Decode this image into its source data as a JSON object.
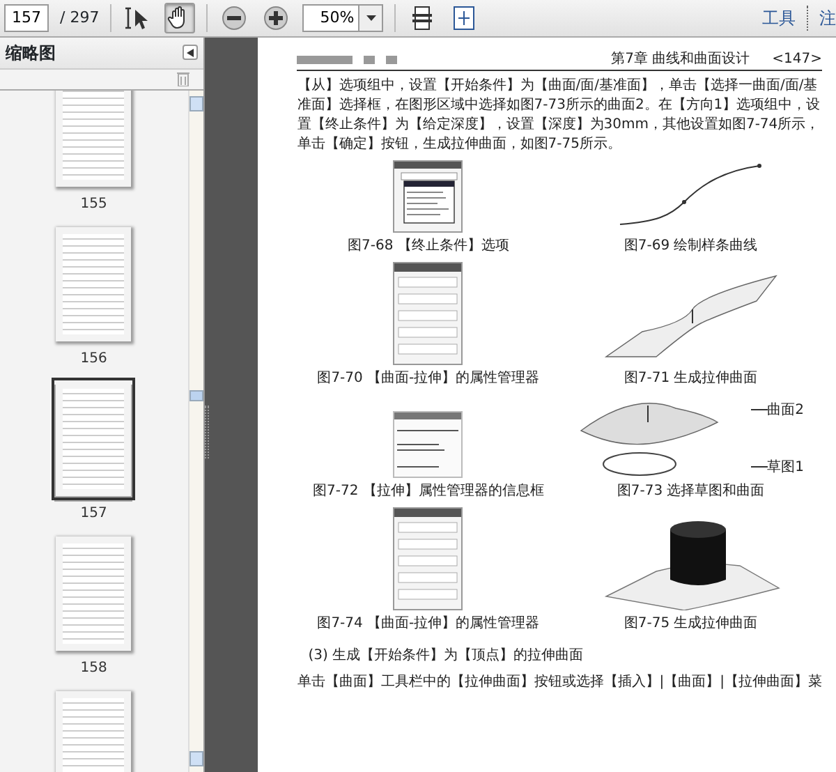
{
  "toolbar": {
    "page_number": "157",
    "page_count": "/ 297",
    "tools": [
      {
        "kind": "select",
        "selected": false
      },
      {
        "kind": "hand",
        "selected": true
      }
    ],
    "zoom": "50%",
    "menus": [
      "工具",
      "注"
    ]
  },
  "sidebar": {
    "title": "缩略图",
    "thumbnails": [
      {
        "label": "155",
        "selected": false
      },
      {
        "label": "156",
        "selected": false
      },
      {
        "label": "157",
        "selected": true
      },
      {
        "label": "158",
        "selected": false
      },
      {
        "selected": false
      }
    ]
  },
  "document": {
    "chapter": "第7章  曲线和曲面设计",
    "page_label": "<147>",
    "paragraph": "【从】选项组中，设置【开始条件】为【曲面/面/基准面】，单击【选择一曲面/面/基准面】选择框，在图形区域中选择如图7-73所示的曲面2。在【方向1】选项组中，设置【终止条件】为【给定深度】，设置【深度】为30mm，其他设置如图7-74所示，单击【确定】按钮，生成拉伸曲面，如图7-75所示。",
    "figure_rows": [
      {
        "figures": [
          {
            "kind": "dropdown-dialog",
            "caption": "图7-68  【终止条件】选项"
          },
          {
            "kind": "spline",
            "caption": "图7-69  绘制样条曲线"
          }
        ]
      },
      {
        "figures": [
          {
            "kind": "dialog",
            "caption": "图7-70  【曲面-拉伸】的属性管理器"
          },
          {
            "kind": "surface",
            "caption": "图7-71  生成拉伸曲面"
          }
        ]
      },
      {
        "figures": [
          {
            "kind": "info-dialog",
            "caption": "图7-72  【拉伸】属性管理器的信息框"
          },
          {
            "kind": "surface-sketch",
            "caption": "图7-73  选择草图和曲面",
            "labels": [
              "曲面2",
              "草图1"
            ]
          }
        ]
      },
      {
        "figures": [
          {
            "kind": "dialog",
            "caption": "图7-74  【曲面-拉伸】的属性管理器"
          },
          {
            "kind": "extrusion",
            "caption": "图7-75  生成拉伸曲面"
          }
        ]
      }
    ],
    "section_heading": "(3) 生成【开始条件】为【顶点】的拉伸曲面",
    "last_line": "单击【曲面】工具栏中的【拉伸曲面】按钮或选择【插入】|【曲面】|【拉伸曲面】菜"
  }
}
